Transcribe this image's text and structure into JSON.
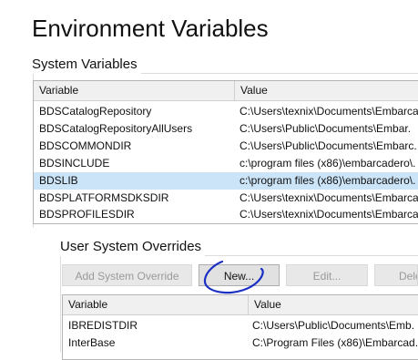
{
  "window": {
    "title": "Environment Variables"
  },
  "system_variables": {
    "group_label": "System Variables",
    "columns": [
      "Variable",
      "Value"
    ],
    "rows": [
      {
        "variable": "BDSCatalogRepository",
        "value": "C:\\Users\\texnix\\Documents\\Embarca"
      },
      {
        "variable": "BDSCatalogRepositoryAllUsers",
        "value": "C:\\Users\\Public\\Documents\\Embar."
      },
      {
        "variable": "BDSCOMMONDIR",
        "value": "C:\\Users\\Public\\Documents\\Embarc."
      },
      {
        "variable": "BDSINCLUDE",
        "value": "c:\\program files (x86)\\embarcadero\\."
      },
      {
        "variable": "BDSLIB",
        "value": "c:\\program files (x86)\\embarcadero\\.",
        "selected": true
      },
      {
        "variable": "BDSPLATFORMSDKSDIR",
        "value": "C:\\Users\\texnix\\Documents\\Embarca"
      },
      {
        "variable": "BDSPROFILESDIR",
        "value": "C:\\Users\\texnix\\Documents\\Embarca"
      }
    ]
  },
  "user_system_overrides": {
    "group_label": "User System Overrides",
    "buttons": {
      "add_override": "Add System Override",
      "new": "New...",
      "edit": "Edit...",
      "delete": "Dele"
    },
    "columns": [
      "Variable",
      "Value"
    ],
    "rows": [
      {
        "variable": "IBREDISTDIR",
        "value": "C:\\Users\\Public\\Documents\\Emb."
      },
      {
        "variable": "InterBase",
        "value": "C:\\Program Files (x86)\\Embarcad."
      }
    ]
  },
  "annotation_color": "#1a2fc4"
}
